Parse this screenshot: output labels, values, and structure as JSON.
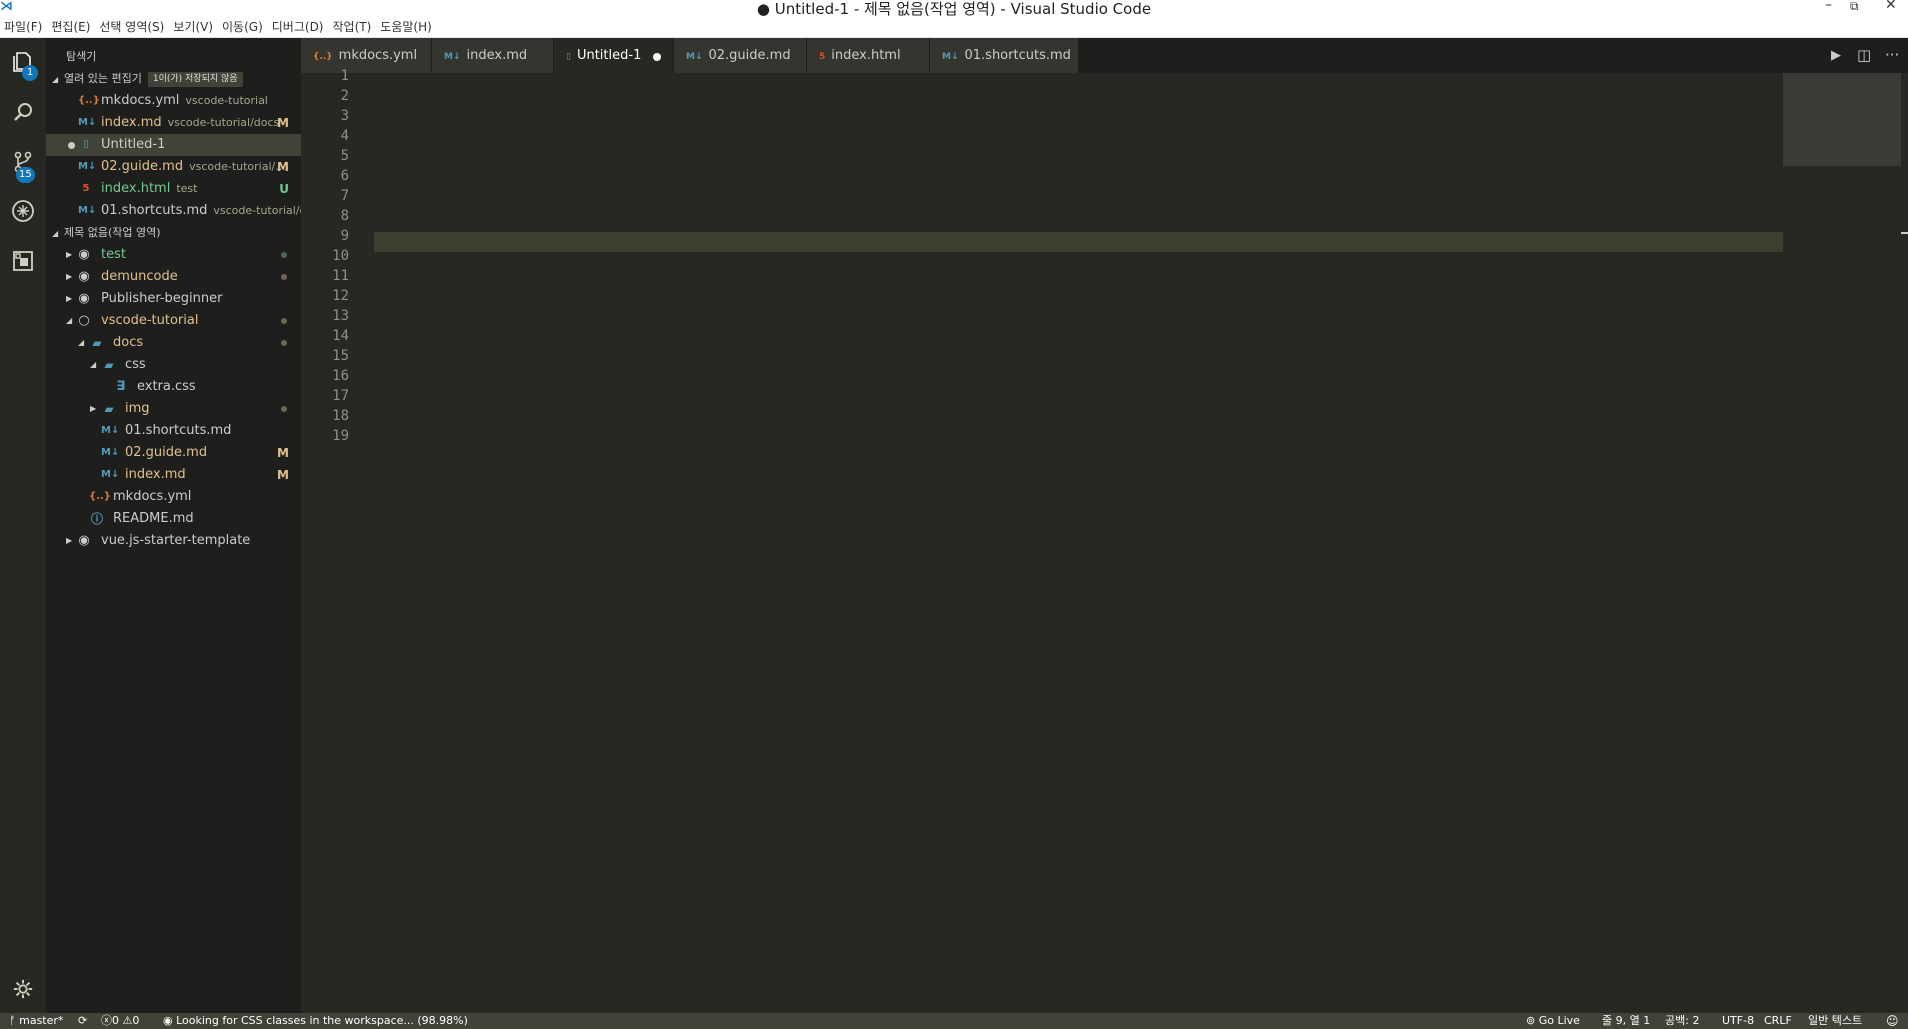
{
  "window": {
    "title": "● Untitled-1 - 제목 없음(작업 영역) - Visual Studio Code",
    "app_icon": "vscode-logo-icon",
    "controls": [
      "minimize-icon",
      "restore-icon",
      "close-icon"
    ]
  },
  "menu": [
    "파일(F)",
    "편집(E)",
    "선택 영역(S)",
    "보기(V)",
    "이동(G)",
    "디버그(D)",
    "작업(T)",
    "도움말(H)"
  ],
  "activity_bar": {
    "explorer_badge": "1",
    "scm_badge": "15",
    "icons": [
      "files-icon",
      "search-icon",
      "source-control-icon",
      "debug-icon",
      "extensions-icon",
      "gear-icon"
    ]
  },
  "sidebar": {
    "title": "탐색기",
    "open_editors": {
      "header": "열려 있는 편집기",
      "badge": "1이(가) 저장되지 않음",
      "items": [
        {
          "icon": "{..}",
          "name": "mkdocs.yml",
          "desc": "vscode-tutorial",
          "status": ""
        },
        {
          "icon": "M↓",
          "name": "index.md",
          "desc": "vscode-tutorial/docs",
          "status": "M"
        },
        {
          "icon": "▯",
          "name": "Untitled-1",
          "desc": "",
          "status": ""
        },
        {
          "icon": "M↓",
          "name": "02.guide.md",
          "desc": "vscode-tutorial/...",
          "status": "M"
        },
        {
          "icon": "5",
          "name": "index.html",
          "desc": "test",
          "status": "U"
        },
        {
          "icon": "M↓",
          "name": "01.shortcuts.md",
          "desc": "vscode-tutorial/do...",
          "status": ""
        }
      ]
    },
    "workspace": {
      "header": "제목 없음(작업 영역)",
      "items": [
        {
          "name": "test",
          "level": 0
        },
        {
          "name": "demuncode",
          "level": 0
        },
        {
          "name": "Publisher-beginner",
          "level": 0
        },
        {
          "name": "vscode-tutorial",
          "level": 0
        },
        {
          "name": "docs",
          "level": 1
        },
        {
          "name": "css",
          "level": 2
        },
        {
          "name": "extra.css",
          "level": 3
        },
        {
          "name": "img",
          "level": 2
        },
        {
          "name": "01.shortcuts.md",
          "level": 2
        },
        {
          "name": "02.guide.md",
          "level": 2,
          "status": "M"
        },
        {
          "name": "index.md",
          "level": 2,
          "status": "M"
        },
        {
          "name": "mkdocs.yml",
          "level": 1
        },
        {
          "name": "README.md",
          "level": 1
        },
        {
          "name": "vue.js-starter-template",
          "level": 0
        }
      ]
    }
  },
  "tabs": [
    {
      "icon": "{..}",
      "label": "mkdocs.yml"
    },
    {
      "icon": "M↓",
      "label": "index.md"
    },
    {
      "icon": "▯",
      "label": "Untitled-1",
      "active": true,
      "dirty": true
    },
    {
      "icon": "M↓",
      "label": "02.guide.md"
    },
    {
      "icon": "5",
      "label": "index.html"
    },
    {
      "icon": "M↓",
      "label": "01.shortcuts.md"
    }
  ],
  "tab_actions": [
    "run-icon",
    "split-editor-icon",
    "more-icon"
  ],
  "editor": {
    "line_numbers": [
      "1",
      "2",
      "3",
      "4",
      "5",
      "6",
      "7",
      "8",
      "9",
      "10",
      "11",
      "12",
      "13",
      "14",
      "15",
      "16",
      "17",
      "18",
      "19"
    ],
    "current_line": 9
  },
  "statusbar": {
    "branch": "master*",
    "errors": "0",
    "warnings": "0",
    "message": "Looking for CSS classes in the workspace... (98.98%)",
    "golive": "Go Live",
    "position": "줄 9, 열 1",
    "spaces": "공백: 2",
    "encoding": "UTF-8",
    "eol": "CRLF",
    "language": "일반 텍스트"
  },
  "colors": {
    "editor_bg": "#272822",
    "sidebar_bg": "#1e1f1c",
    "current_line": "#3e3d32",
    "modified": "#e2c08d",
    "untracked": "#73c991",
    "statusbar": "#414339"
  }
}
